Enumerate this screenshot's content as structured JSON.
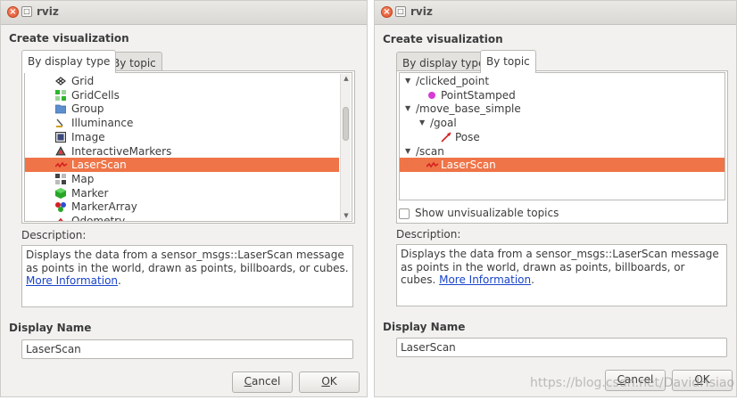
{
  "left": {
    "window_title": "rviz",
    "create_label": "Create visualization",
    "tabs": [
      "By display type",
      "By topic"
    ],
    "display_types": [
      {
        "label": "Grid",
        "icon": "grid-icon"
      },
      {
        "label": "GridCells",
        "icon": "gridcells-icon"
      },
      {
        "label": "Group",
        "icon": "folder-icon"
      },
      {
        "label": "Illuminance",
        "icon": "illuminance-icon"
      },
      {
        "label": "Image",
        "icon": "image-icon"
      },
      {
        "label": "InteractiveMarkers",
        "icon": "interactive-markers-icon"
      },
      {
        "label": "LaserScan",
        "icon": "laserscan-icon",
        "selected": true
      },
      {
        "label": "Map",
        "icon": "map-icon"
      },
      {
        "label": "Marker",
        "icon": "marker-icon"
      },
      {
        "label": "MarkerArray",
        "icon": "marker-array-icon"
      },
      {
        "label": "Odometry",
        "icon": "odometry-icon"
      }
    ],
    "description_label": "Description:",
    "description_text": "Displays the data from a sensor_msgs::LaserScan message as points in the world, drawn as points, billboards, or cubes. ",
    "description_link": "More Information",
    "description_end": ".",
    "display_name_label": "Display Name",
    "display_name_value": "LaserScan",
    "cancel": {
      "pre": "",
      "u": "C",
      "post": "ancel"
    },
    "ok": {
      "pre": "",
      "u": "O",
      "post": "K"
    }
  },
  "right": {
    "window_title": "rviz",
    "create_label": "Create visualization",
    "tabs": [
      "By display type",
      "By topic"
    ],
    "tree": [
      {
        "label": "/clicked_point",
        "level": 0,
        "expander": true
      },
      {
        "label": "PointStamped",
        "level": 1,
        "icon": "point-stamped-icon"
      },
      {
        "label": "/move_base_simple",
        "level": 0,
        "expander": true
      },
      {
        "label": "/goal",
        "level": 1,
        "expander": true
      },
      {
        "label": "Pose",
        "level": 2,
        "icon": "pose-icon"
      },
      {
        "label": "/scan",
        "level": 0,
        "expander": true
      },
      {
        "label": "LaserScan",
        "level": 1,
        "icon": "laserscan-icon",
        "selected": true
      }
    ],
    "show_unvisualizable": "Show unvisualizable topics",
    "show_unvisualizable_checked": false,
    "description_label": "Description:",
    "description_text": "Displays the data from a sensor_msgs::LaserScan message as points in the world, drawn as points, billboards, or cubes. ",
    "description_link": "More Information",
    "description_end": ".",
    "display_name_label": "Display Name",
    "display_name_value": "LaserScan",
    "cancel": {
      "pre": "",
      "u": "C",
      "post": "ancel"
    },
    "ok": {
      "pre": "",
      "u": "O",
      "post": "K"
    }
  },
  "watermark": "https://blog.csdn.net/DavidHsiao",
  "colors": {
    "selection": "#ef7447",
    "link": "#1a44c9"
  }
}
